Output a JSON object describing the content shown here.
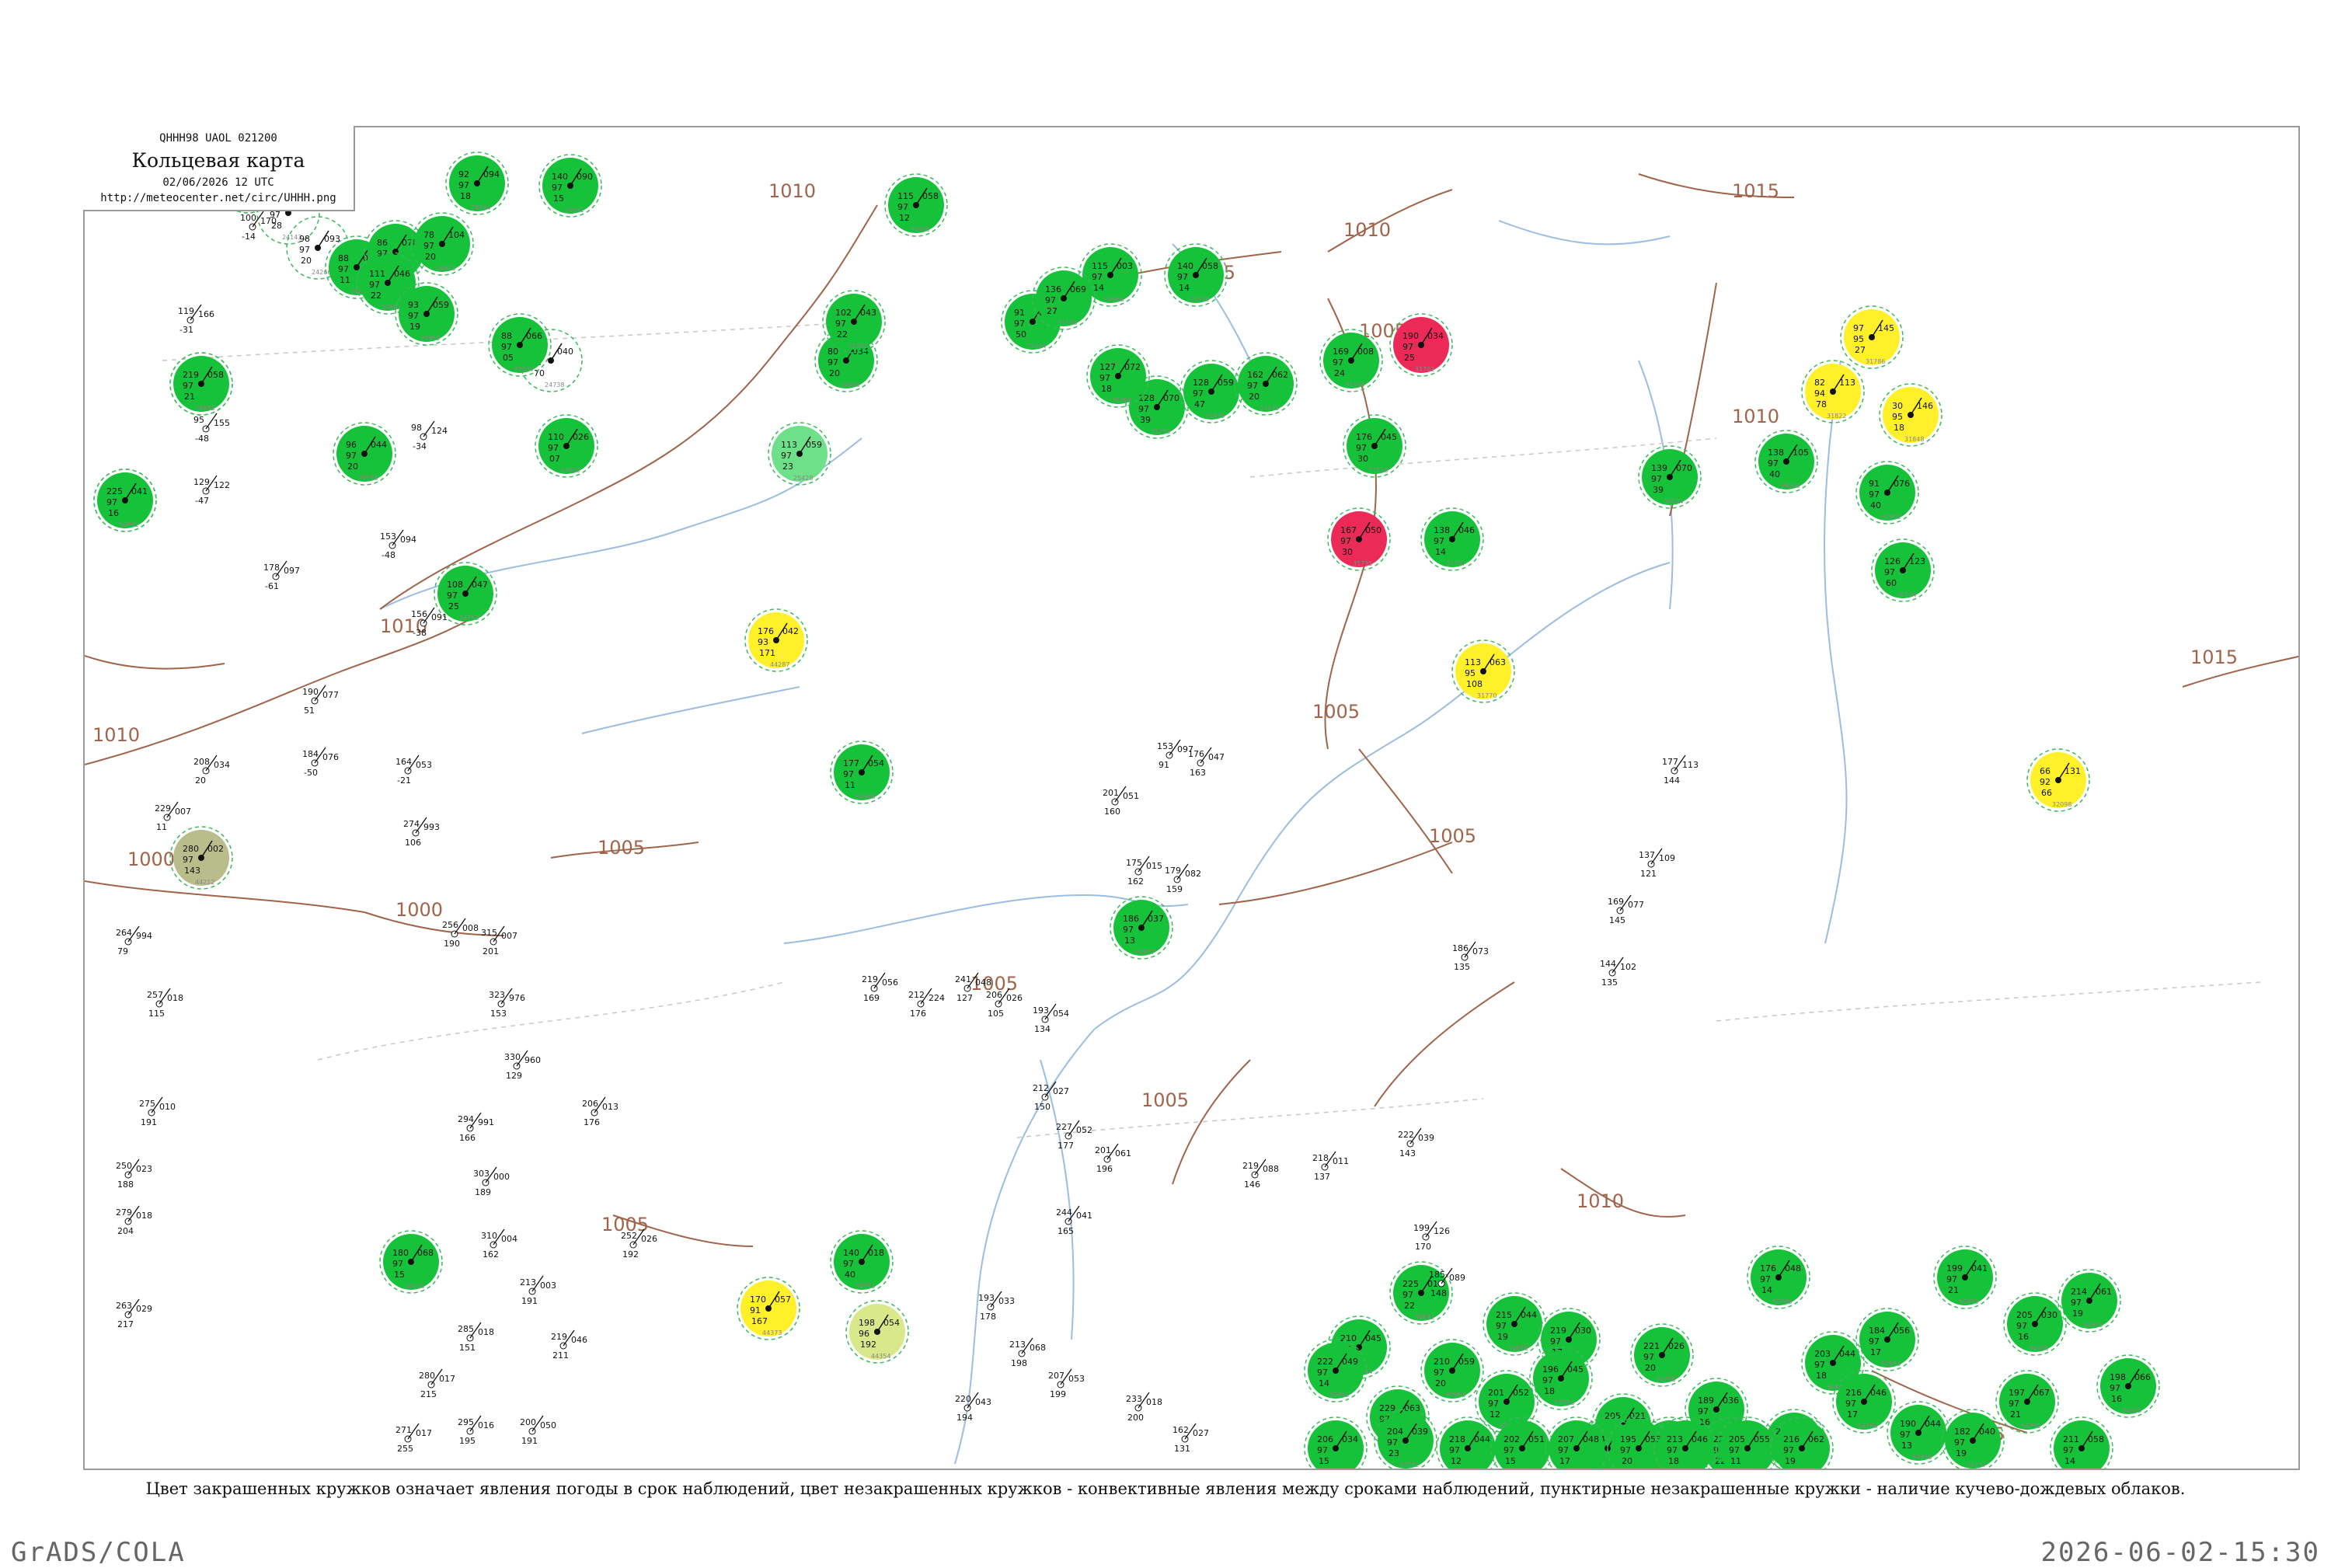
{
  "header": {
    "code_line": "QHHH98  UAOL  021200",
    "title": "Кольцевая карта",
    "date_line": "02/06/2026 12 UTC",
    "url": "http://meteocenter.net/circ/UHHH.png"
  },
  "footnote": "Цвет закрашенных кружков означает явления погоды в срок наблюдений, цвет незакрашенных кружков - конвективные явления между сроками наблюдений, пунктирные незакрашенные кружки - наличие кучево-дождевых облаков.",
  "footer_left": "GrADS/COLA",
  "footer_right": "2026-06-02-15:30",
  "colors": {
    "rain_fill": "#16c23a",
    "rain_light_fill": "#6ee08a",
    "thunder_fill": "#ec2a58",
    "shower_fill": "#fff02a",
    "haze_fill": "#d8e88a",
    "mist_fill": "#b9bd8c",
    "cb_dashed": "#3cb85a",
    "convective_ring": "#e0506a",
    "isobar": "#a0644a",
    "river": "#9bbde0",
    "border": "#9a9a9a"
  },
  "isobars": [
    {
      "label": "1010"
    },
    {
      "label": "1010"
    },
    {
      "label": "1005"
    },
    {
      "label": "1005"
    },
    {
      "label": "1010"
    },
    {
      "label": "1005"
    },
    {
      "label": "1015"
    },
    {
      "label": "1010"
    },
    {
      "label": "1015"
    },
    {
      "label": "1010"
    },
    {
      "label": "1005"
    },
    {
      "label": "1000"
    },
    {
      "label": "1000"
    },
    {
      "label": "1005"
    },
    {
      "label": "1005"
    },
    {
      "label": "1005"
    },
    {
      "label": "1010"
    },
    {
      "label": "1005"
    },
    {
      "label": "1015"
    }
  ],
  "stations": [
    {
      "id": "21432",
      "t": "137",
      "p": "122",
      "dew": "97",
      "v": "60",
      "type": "cb"
    },
    {
      "id": "23552",
      "t": "85",
      "p": "154",
      "dew": "97",
      "v": "-20",
      "type": "cb"
    },
    {
      "id": "24125",
      "t": "111",
      "p": "135",
      "dew": "97",
      "v": "-04",
      "type": "cb"
    },
    {
      "id": "24051",
      "t": "76",
      "p": "136",
      "dew": "97",
      "v": "12",
      "type": "rain"
    },
    {
      "id": "24143",
      "t": "71",
      "p": "108",
      "dew": "97",
      "v": "28",
      "type": "cb"
    },
    {
      "id": "24266",
      "t": "98",
      "p": "093",
      "dew": "97",
      "v": "20",
      "type": "cb"
    },
    {
      "id": "24507",
      "t": "88",
      "p": "098",
      "dew": "97",
      "v": "11",
      "type": "rain"
    },
    {
      "id": "24477",
      "t": "86",
      "p": "078",
      "dew": "97",
      "v": "24",
      "type": "rain"
    },
    {
      "id": "24641",
      "t": "140",
      "p": "090",
      "dew": "97",
      "v": "15",
      "type": "rain"
    },
    {
      "id": "24944",
      "t": "92",
      "p": "094",
      "dew": "97",
      "v": "18",
      "type": "rain"
    },
    {
      "id": "24643",
      "t": "78",
      "p": "104",
      "dew": "97",
      "v": "20",
      "type": "rain"
    },
    {
      "id": "24691",
      "t": "111",
      "p": "046",
      "dew": "97",
      "v": "22",
      "type": "rain"
    },
    {
      "id": "24738",
      "t": "85",
      "p": "040",
      "dew": "97",
      "v": "70",
      "type": "cb"
    },
    {
      "id": "24763",
      "t": "108",
      "p": "047",
      "dew": "97",
      "v": "25",
      "type": "rain"
    },
    {
      "id": "24959",
      "t": "93",
      "p": "059",
      "dew": "97",
      "v": "19",
      "type": "rain"
    },
    {
      "id": "25138",
      "t": "96",
      "p": "044",
      "dew": "97",
      "v": "20",
      "type": "rain"
    },
    {
      "id": "31004",
      "t": "88",
      "p": "066",
      "dew": "97",
      "v": "05",
      "type": "rain"
    },
    {
      "id": "24966",
      "t": "115",
      "p": "003",
      "dew": "97",
      "v": "14",
      "type": "rain"
    },
    {
      "id": "25344",
      "t": "91",
      "p": "045",
      "dew": "97",
      "v": "50",
      "type": "rain"
    },
    {
      "id": "24980",
      "t": "110",
      "p": "026",
      "dew": "97",
      "v": "07",
      "type": "rain"
    },
    {
      "id": "25428",
      "t": "113",
      "p": "059",
      "dew": "97",
      "v": "23",
      "type": "rain_light"
    },
    {
      "id": "24908",
      "t": "80",
      "p": "034",
      "dew": "97",
      "v": "20",
      "type": "rain"
    },
    {
      "id": "31062",
      "t": "102",
      "p": "043",
      "dew": "97",
      "v": "22",
      "type": "rain"
    },
    {
      "id": "31088",
      "t": "115",
      "p": "058",
      "dew": "97",
      "v": "12",
      "type": "rain"
    },
    {
      "id": "31168",
      "t": "136",
      "p": "069",
      "dew": "97",
      "v": "27",
      "type": "rain"
    },
    {
      "id": "31253",
      "t": "128",
      "p": "070",
      "dew": "97",
      "v": "39",
      "type": "rain"
    },
    {
      "id": "31329",
      "t": "140",
      "p": "058",
      "dew": "97",
      "v": "14",
      "type": "rain"
    },
    {
      "id": "31369",
      "t": "127",
      "p": "072",
      "dew": "97",
      "v": "18",
      "type": "rain"
    },
    {
      "id": "31439",
      "t": "128",
      "p": "059",
      "dew": "97",
      "v": "47",
      "type": "rain"
    },
    {
      "id": "31415",
      "t": "162",
      "p": "062",
      "dew": "97",
      "v": "20",
      "type": "rain"
    },
    {
      "id": "31538",
      "t": "176",
      "p": "045",
      "dew": "97",
      "v": "30",
      "type": "rain"
    },
    {
      "id": "31594",
      "t": "169",
      "p": "008",
      "dew": "97",
      "v": "24",
      "type": "rain"
    },
    {
      "id": "31702",
      "t": "190",
      "p": "034",
      "dew": "97",
      "v": "25",
      "type": "thunder"
    },
    {
      "id": "31735",
      "t": "167",
      "p": "050",
      "dew": "97",
      "v": "30",
      "type": "thunder"
    },
    {
      "id": "31707",
      "t": "138",
      "p": "046",
      "dew": "97",
      "v": "14",
      "type": "rain"
    },
    {
      "id": "31770",
      "t": "113",
      "p": "063",
      "dew": "95",
      "v": "108",
      "type": "shower"
    },
    {
      "id": "31786",
      "t": "97",
      "p": "145",
      "dew": "95",
      "v": "27",
      "type": "shower"
    },
    {
      "id": "31822",
      "t": "82",
      "p": "113",
      "dew": "94",
      "v": "78",
      "type": "shower"
    },
    {
      "id": "31848",
      "t": "30",
      "p": "146",
      "dew": "95",
      "v": "18",
      "type": "shower"
    },
    {
      "id": "32098",
      "t": "66",
      "p": "131",
      "dew": "92",
      "v": "66",
      "type": "shower"
    },
    {
      "id": "31909",
      "t": "91",
      "p": "076",
      "dew": "97",
      "v": "40",
      "type": "rain"
    },
    {
      "id": "36034",
      "t": "139",
      "p": "070",
      "dew": "97",
      "v": "39",
      "type": "rain"
    },
    {
      "id": "36096",
      "t": "138",
      "p": "105",
      "dew": "97",
      "v": "40",
      "type": "rain"
    },
    {
      "id": "36104",
      "t": "126",
      "p": "123",
      "dew": "97",
      "v": "60",
      "type": "rain"
    },
    {
      "id": "44212",
      "t": "280",
      "p": "002",
      "dew": "97",
      "v": "143",
      "type": "mist"
    },
    {
      "id": "44287",
      "t": "176",
      "p": "042",
      "dew": "93",
      "v": "171",
      "type": "shower"
    },
    {
      "id": "44373",
      "t": "170",
      "p": "057",
      "dew": "91",
      "v": "167",
      "type": "shower"
    },
    {
      "id": "44354",
      "t": "198",
      "p": "054",
      "dew": "96",
      "v": "192",
      "type": "haze"
    },
    {
      "id": "50136",
      "t": "180",
      "p": "068",
      "dew": "97",
      "v": "15",
      "type": "rain"
    },
    {
      "id": "50353",
      "t": "140",
      "p": "018",
      "dew": "97",
      "v": "40",
      "type": "rain"
    },
    {
      "id": "50468",
      "t": "177",
      "p": "054",
      "dew": "97",
      "v": "11",
      "type": "rain"
    },
    {
      "id": "50527",
      "t": "186",
      "p": "037",
      "dew": "97",
      "v": "13",
      "type": "rain"
    },
    {
      "id": "50564",
      "t": "210",
      "p": "045",
      "dew": "97",
      "v": "14",
      "type": "rain"
    },
    {
      "id": "50603",
      "t": "206",
      "p": "034",
      "dew": "97",
      "v": "15",
      "type": "rain"
    },
    {
      "id": "50632",
      "t": "225",
      "p": "016",
      "dew": "97",
      "v": "22",
      "type": "rain"
    },
    {
      "id": "50656",
      "t": "215",
      "p": "044",
      "dew": "97",
      "v": "19",
      "type": "rain"
    },
    {
      "id": "50727",
      "t": "219",
      "p": "030",
      "dew": "97",
      "v": "17",
      "type": "rain"
    },
    {
      "id": "50745",
      "t": "205",
      "p": "021",
      "dew": "97",
      "v": "13",
      "type": "rain"
    },
    {
      "id": "50756",
      "t": "221",
      "p": "026",
      "dew": "97",
      "v": "20",
      "type": "rain"
    },
    {
      "id": "50774",
      "t": "189",
      "p": "036",
      "dew": "97",
      "v": "16",
      "type": "rain"
    },
    {
      "id": "50788",
      "t": "176",
      "p": "048",
      "dew": "97",
      "v": "14",
      "type": "rain"
    },
    {
      "id": "50844",
      "t": "203",
      "p": "044",
      "dew": "97",
      "v": "18",
      "type": "rain"
    },
    {
      "id": "50853",
      "t": "184",
      "p": "056",
      "dew": "97",
      "v": "17",
      "type": "rain"
    },
    {
      "id": "50873",
      "t": "199",
      "p": "041",
      "dew": "97",
      "v": "21",
      "type": "rain"
    },
    {
      "id": "50888",
      "t": "205",
      "p": "030",
      "dew": "97",
      "v": "16",
      "type": "rain"
    },
    {
      "id": "50915",
      "t": "214",
      "p": "061",
      "dew": "97",
      "v": "19",
      "type": "rain"
    },
    {
      "id": "50949",
      "t": "222",
      "p": "049",
      "dew": "97",
      "v": "14",
      "type": "rain"
    },
    {
      "id": "50953",
      "t": "229",
      "p": "063",
      "dew": "97",
      "v": "23",
      "type": "rain"
    },
    {
      "id": "50963",
      "t": "210",
      "p": "059",
      "dew": "97",
      "v": "20",
      "type": "rain"
    },
    {
      "id": "50978",
      "t": "201",
      "p": "052",
      "dew": "97",
      "v": "12",
      "type": "rain"
    },
    {
      "id": "50983",
      "t": "196",
      "p": "045",
      "dew": "97",
      "v": "18",
      "type": "rain"
    },
    {
      "id": "54026",
      "t": "214",
      "p": "070",
      "dew": "97",
      "v": "20",
      "type": "rain"
    },
    {
      "id": "54094",
      "t": "207",
      "p": "042",
      "dew": "97",
      "v": "19",
      "type": "rain"
    },
    {
      "id": "54096",
      "t": "229",
      "p": "051",
      "dew": "97",
      "v": "22",
      "type": "rain"
    },
    {
      "id": "54157",
      "t": "208",
      "p": "059",
      "dew": "97",
      "v": "15",
      "type": "rain"
    },
    {
      "id": "54186",
      "t": "216",
      "p": "046",
      "dew": "97",
      "v": "17",
      "type": "rain"
    },
    {
      "id": "54236",
      "t": "190",
      "p": "044",
      "dew": "97",
      "v": "13",
      "type": "rain"
    },
    {
      "id": "54237",
      "t": "182",
      "p": "040",
      "dew": "97",
      "v": "19",
      "type": "rain"
    },
    {
      "id": "54259",
      "t": "197",
      "p": "067",
      "dew": "97",
      "v": "21",
      "type": "rain"
    },
    {
      "id": "54273",
      "t": "211",
      "p": "058",
      "dew": "97",
      "v": "14",
      "type": "rain"
    },
    {
      "id": "54285",
      "t": "198",
      "p": "066",
      "dew": "97",
      "v": "16",
      "type": "rain"
    },
    {
      "id": "54292",
      "t": "204",
      "p": "039",
      "dew": "97",
      "v": "23",
      "type": "rain"
    },
    {
      "id": "54377",
      "t": "218",
      "p": "044",
      "dew": "97",
      "v": "12",
      "type": "rain"
    },
    {
      "id": "54386",
      "t": "202",
      "p": "051",
      "dew": "97",
      "v": "15",
      "type": "rain"
    },
    {
      "id": "54387",
      "t": "207",
      "p": "048",
      "dew": "97",
      "v": "17",
      "type": "rain"
    },
    {
      "id": "54388",
      "t": "195",
      "p": "053",
      "dew": "97",
      "v": "20",
      "type": "rain"
    },
    {
      "id": "54497",
      "t": "213",
      "p": "046",
      "dew": "97",
      "v": "18",
      "type": "rain"
    },
    {
      "id": "54514",
      "t": "205",
      "p": "055",
      "dew": "97",
      "v": "11",
      "type": "rain"
    },
    {
      "id": "54579",
      "t": "216",
      "p": "062",
      "dew": "97",
      "v": "19",
      "type": "rain"
    },
    {
      "id": "54662",
      "t": "225",
      "p": "041",
      "dew": "97",
      "v": "16",
      "type": "rain"
    },
    {
      "id": "54678",
      "t": "219",
      "p": "058",
      "dew": "97",
      "v": "21",
      "type": "rain"
    },
    {
      "id": "54735",
      "t": "188",
      "p": "063",
      "dew": "97",
      "v": "18",
      "type": "rain"
    },
    {
      "id": "54753",
      "t": "173",
      "p": "075",
      "dew": "97",
      "v": "20",
      "type": "rain"
    }
  ],
  "station_numbers": [
    {
      "t": "100",
      "p": "170",
      "v": "-14"
    },
    {
      "t": "119",
      "p": "166",
      "v": "-31"
    },
    {
      "t": "129",
      "p": "122",
      "v": "-47"
    },
    {
      "t": "95",
      "p": "155",
      "v": "-48"
    },
    {
      "t": "178",
      "p": "097",
      "v": "-61"
    },
    {
      "t": "190",
      "p": "077",
      "v": "51"
    },
    {
      "t": "184",
      "p": "076",
      "v": "-50"
    },
    {
      "t": "208",
      "p": "034",
      "v": "20"
    },
    {
      "t": "229",
      "p": "007",
      "v": "11"
    },
    {
      "t": "264",
      "p": "994",
      "v": "79"
    },
    {
      "t": "257",
      "p": "018",
      "v": "115"
    },
    {
      "t": "275",
      "p": "010",
      "v": "191"
    },
    {
      "t": "279",
      "p": "018",
      "v": "204"
    },
    {
      "t": "263",
      "p": "029",
      "v": "217"
    },
    {
      "t": "250",
      "p": "023",
      "v": "188"
    },
    {
      "t": "98",
      "p": "124",
      "v": "-34"
    },
    {
      "t": "153",
      "p": "094",
      "v": "-48"
    },
    {
      "t": "156",
      "p": "091",
      "v": "-38"
    },
    {
      "t": "164",
      "p": "053",
      "v": "-21"
    },
    {
      "t": "274",
      "p": "993",
      "v": "106"
    },
    {
      "t": "256",
      "p": "008",
      "v": "190"
    },
    {
      "t": "315",
      "p": "007",
      "v": "201"
    },
    {
      "t": "323",
      "p": "976",
      "v": "153"
    },
    {
      "t": "330",
      "p": "960",
      "v": "129"
    },
    {
      "t": "294",
      "p": "991",
      "v": "166"
    },
    {
      "t": "303",
      "p": "000",
      "v": "189"
    },
    {
      "t": "310",
      "p": "004",
      "v": "162"
    },
    {
      "t": "285",
      "p": "018",
      "v": "151"
    },
    {
      "t": "280",
      "p": "017",
      "v": "215"
    },
    {
      "t": "271",
      "p": "017",
      "v": "255"
    },
    {
      "t": "295",
      "p": "016",
      "v": "195"
    },
    {
      "t": "213",
      "p": "003",
      "v": "191"
    },
    {
      "t": "219",
      "p": "046",
      "v": "211"
    },
    {
      "t": "200",
      "p": "050",
      "v": "191"
    },
    {
      "t": "252",
      "p": "026",
      "v": "192"
    },
    {
      "t": "206",
      "p": "013",
      "v": "176"
    },
    {
      "t": "212",
      "p": "224",
      "v": "176"
    },
    {
      "t": "219",
      "p": "056",
      "v": "169"
    },
    {
      "t": "241",
      "p": "048",
      "v": "127"
    },
    {
      "t": "193",
      "p": "054",
      "v": "134"
    },
    {
      "t": "206",
      "p": "026",
      "v": "105"
    },
    {
      "t": "212",
      "p": "027",
      "v": "150"
    },
    {
      "t": "227",
      "p": "052",
      "v": "177"
    },
    {
      "t": "201",
      "p": "061",
      "v": "196"
    },
    {
      "t": "244",
      "p": "041",
      "v": "165"
    },
    {
      "t": "193",
      "p": "033",
      "v": "178"
    },
    {
      "t": "213",
      "p": "068",
      "v": "198"
    },
    {
      "t": "207",
      "p": "053",
      "v": "199"
    },
    {
      "t": "220",
      "p": "043",
      "v": "194"
    },
    {
      "t": "233",
      "p": "018",
      "v": "200"
    },
    {
      "t": "162",
      "p": "027",
      "v": "131"
    },
    {
      "t": "175",
      "p": "015",
      "v": "162"
    },
    {
      "t": "179",
      "p": "082",
      "v": "159"
    },
    {
      "t": "176",
      "p": "047",
      "v": "163"
    },
    {
      "t": "153",
      "p": "097",
      "v": "91"
    },
    {
      "t": "201",
      "p": "051",
      "v": "160"
    },
    {
      "t": "219",
      "p": "088",
      "v": "146"
    },
    {
      "t": "218",
      "p": "011",
      "v": "137"
    },
    {
      "t": "222",
      "p": "039",
      "v": "143"
    },
    {
      "t": "199",
      "p": "126",
      "v": "170"
    },
    {
      "t": "185",
      "p": "089",
      "v": "148"
    },
    {
      "t": "186",
      "p": "073",
      "v": "135"
    },
    {
      "t": "144",
      "p": "102",
      "v": "135"
    },
    {
      "t": "169",
      "p": "077",
      "v": "145"
    },
    {
      "t": "177",
      "p": "113",
      "v": "144"
    },
    {
      "t": "137",
      "p": "109",
      "v": "121"
    }
  ]
}
